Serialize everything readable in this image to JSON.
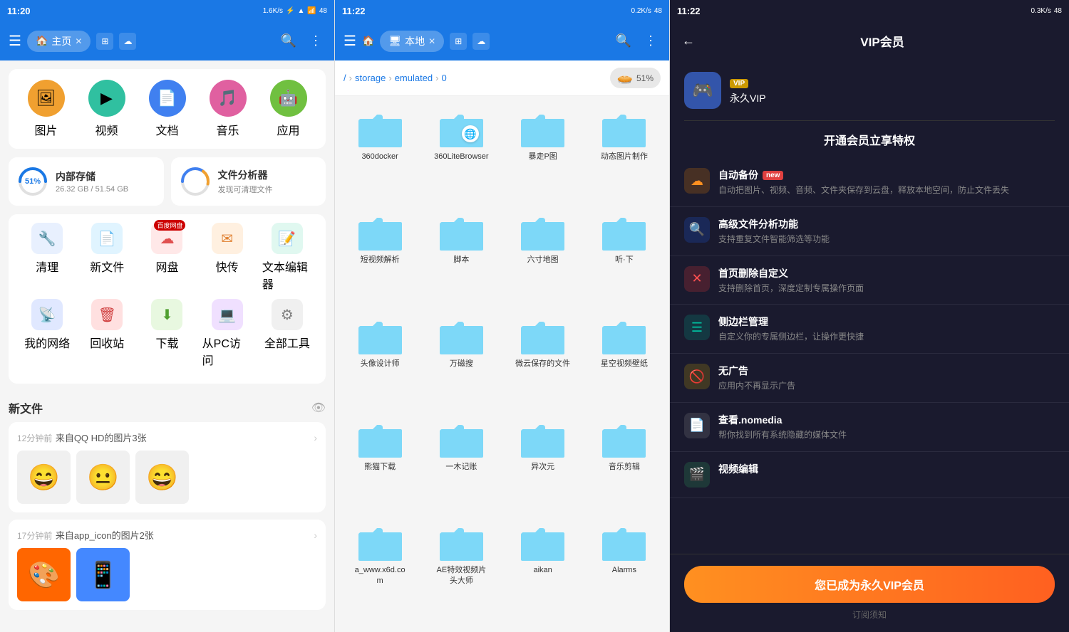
{
  "panel1": {
    "statusBar": {
      "time": "11:20",
      "network": "1.6K/s",
      "battery": "48"
    },
    "header": {
      "menuIcon": "☰",
      "tabLabel": "主页",
      "tabIcon": "🏠",
      "closeIcon": "✕",
      "searchIcon": "🔍",
      "moreIcon": "⋮"
    },
    "categories": [
      {
        "label": "图片",
        "icon": "🖼",
        "colorClass": "cat-yellow"
      },
      {
        "label": "视频",
        "icon": "▶",
        "colorClass": "cat-teal"
      },
      {
        "label": "文档",
        "icon": "📄",
        "colorClass": "cat-blue"
      },
      {
        "label": "音乐",
        "icon": "🎵",
        "colorClass": "cat-pink"
      },
      {
        "label": "应用",
        "icon": "🤖",
        "colorClass": "cat-green"
      }
    ],
    "internalStorage": {
      "title": "内部存储",
      "size": "26.32 GB / 51.54 GB",
      "percent": 51
    },
    "fileAnalyzer": {
      "title": "文件分析器",
      "subtitle": "发现可清理文件"
    },
    "tools": [
      [
        {
          "label": "清理",
          "icon": "🔧",
          "colorClass": "ti-blue"
        },
        {
          "label": "新文件",
          "icon": "📄",
          "colorClass": "ti-lblue"
        },
        {
          "label": "网盘",
          "icon": "☁",
          "colorClass": "ti-red",
          "badge": "百度网盘"
        },
        {
          "label": "快传",
          "icon": "✉",
          "colorClass": "ti-orange"
        },
        {
          "label": "文本编辑器",
          "icon": "📝",
          "colorClass": "ti-teal"
        }
      ],
      [
        {
          "label": "我的网络",
          "icon": "📡",
          "colorClass": "ti-network"
        },
        {
          "label": "回收站",
          "icon": "🗑",
          "colorClass": "ti-trash"
        },
        {
          "label": "下载",
          "icon": "⬇",
          "colorClass": "ti-download"
        },
        {
          "label": "从PC访问",
          "icon": "💻",
          "colorClass": "ti-purple"
        },
        {
          "label": "全部工具",
          "icon": "⚙",
          "colorClass": "ti-gray"
        }
      ]
    ],
    "newFiles": {
      "title": "新文件",
      "groups": [
        {
          "time": "12分钟前",
          "source": "来自QQ HD的图片3张",
          "thumbs": [
            "😄",
            "😐",
            "😄"
          ]
        },
        {
          "time": "17分钟前",
          "source": "来自app_icon的图片2张",
          "thumbs": [
            "🎨",
            "📱"
          ]
        }
      ]
    }
  },
  "panel2": {
    "statusBar": {
      "time": "11:22",
      "network": "0.2K/s",
      "battery": "48"
    },
    "header": {
      "menuIcon": "☰",
      "tabLabel": "本地",
      "tabIcon": "🖥",
      "closeIcon": "✕",
      "searchIcon": "🔍",
      "moreIcon": "⋮"
    },
    "breadcrumb": {
      "root": "/",
      "path": [
        "storage",
        "emulated",
        "0"
      ]
    },
    "storageBar": {
      "percent": "51%",
      "icon": "⬤"
    },
    "folders": [
      {
        "name": "360docker"
      },
      {
        "name": "360LiteBrowser"
      },
      {
        "name": "暴走P图"
      },
      {
        "name": "动态图片制作"
      },
      {
        "name": "短视频解析"
      },
      {
        "name": "脚本"
      },
      {
        "name": "六寸地图"
      },
      {
        "name": "听·下"
      },
      {
        "name": "头像设计师"
      },
      {
        "name": "万磁搜"
      },
      {
        "name": "微云保存的文件"
      },
      {
        "name": "星空视频壁纸"
      },
      {
        "name": "熊猫下载"
      },
      {
        "name": "一木记账"
      },
      {
        "name": "异次元"
      },
      {
        "name": "音乐剪辑"
      },
      {
        "name": "a_www.x6d.com"
      },
      {
        "name": "AE特效视频片头大师"
      },
      {
        "name": "aikan"
      },
      {
        "name": "Alarms"
      }
    ]
  },
  "panel3": {
    "statusBar": {
      "time": "11:22",
      "network": "0.3K/s",
      "battery": "48"
    },
    "header": {
      "backIcon": "←",
      "title": "VIP会员"
    },
    "profile": {
      "avatarIcon": "🎮",
      "vipBadge": "VIP",
      "username": "永久VIP"
    },
    "featuresTitle": "开通会员立享特权",
    "features": [
      {
        "icon": "☁",
        "colorClass": "fi-orange",
        "title": "自动备份",
        "isNew": true,
        "desc": "自动把图片、视频、音频、文件夹保存到云盘，释放本地空间，防止文件丢失"
      },
      {
        "icon": "🔍",
        "colorClass": "fi-blue",
        "title": "高级文件分析功能",
        "isNew": false,
        "desc": "支持重复文件智能筛选等功能"
      },
      {
        "icon": "✕",
        "colorClass": "fi-red",
        "title": "首页删除自定义",
        "isNew": false,
        "desc": "支持删除首页，深度定制专属操作页面"
      },
      {
        "icon": "☰",
        "colorClass": "fi-teal",
        "title": "侧边栏管理",
        "isNew": false,
        "desc": "自定义你的专属侧边栏，让操作更快捷"
      },
      {
        "icon": "🚫",
        "colorClass": "fi-yellow",
        "title": "无广告",
        "isNew": false,
        "desc": "应用内不再显示广告"
      },
      {
        "icon": "📄",
        "colorClass": "fi-gray",
        "title": "查看.nomedia",
        "isNew": false,
        "desc": "帮你找到所有系统隐藏的媒体文件"
      },
      {
        "icon": "🎬",
        "colorClass": "fi-green",
        "title": "视频编辑",
        "isNew": false,
        "desc": ""
      }
    ],
    "ctaButton": "您已成为永久VIP会员",
    "subText": "订阅须知"
  }
}
